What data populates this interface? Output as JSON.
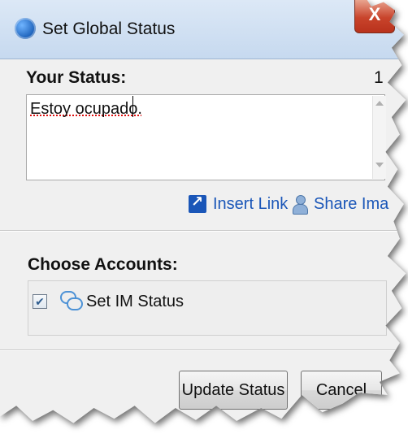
{
  "window": {
    "title": "Set Global Status",
    "close_glyph": "X"
  },
  "status": {
    "label": "Your Status:",
    "counter": "1",
    "text": "Estoy ocupado."
  },
  "links": {
    "insert_link": "Insert Link",
    "share_image": "Share Ima"
  },
  "accounts": {
    "label": "Choose Accounts:",
    "items": [
      {
        "label": "Set IM Status",
        "checked": true,
        "icon": "chat-bubbles-icon"
      }
    ]
  },
  "buttons": {
    "update": "Update Status",
    "cancel": "Cancel"
  },
  "colors": {
    "link": "#1a56b8",
    "close": "#c8432b",
    "titlebar": "#c6d9ef"
  }
}
